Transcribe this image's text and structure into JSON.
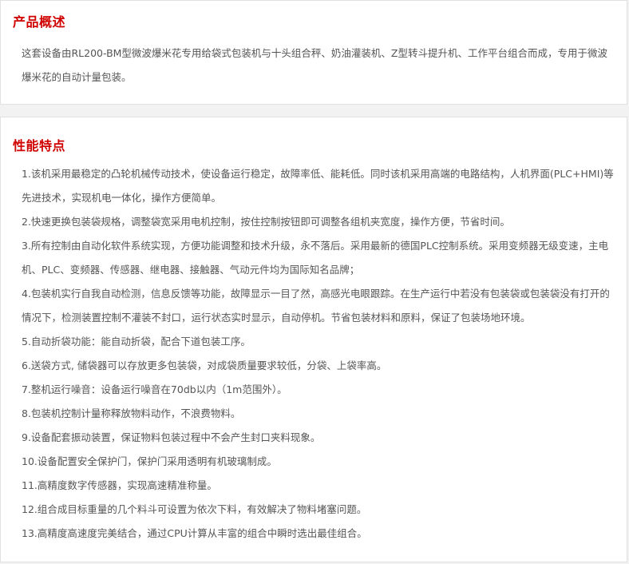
{
  "overview": {
    "title": "产品概述",
    "text": "这套设备由RL200-BM型微波爆米花专用给袋式包装机与十头组合秤、奶油灌装机、Z型转斗提升机、工作平台组合而成，专用于微波爆米花的自动计量包装。"
  },
  "features": {
    "title": "性能特点",
    "items": [
      "1.该机采用最稳定的凸轮机械传动技术，使设备运行稳定，故障率低、能耗低。同时该机采用高端的电路结构，人机界面(PLC+HMI)等先进技术，实现机电一体化，操作方便简单。",
      "2.快速更换包装袋规格，调整袋宽采用电机控制，按住控制按钮即可调整各组机夹宽度，操作方便，节省时间。",
      "3.所有控制由自动化软件系统实现，方便功能调整和技术升级，永不落后。采用最新的德国PLC控制系统。采用变频器无级变速，主电机、PLC、变频器、传感器、继电器、接触器、气动元件均为国际知名品牌；",
      "4.包装机实行自我自动检测，信息反馈等功能，故障显示一目了然，高感光电眼跟踪。在生产运行中若没有包装袋或包装袋没有打开的情况下，检测装置控制不灌装不封口，运行状态实时显示，自动停机。节省包装材料和原料，保证了包装场地环境。",
      "5.自动折袋功能：能自动折袋，配合下道包装工序。",
      "6.送袋方式, 储袋器可以存放更多包装袋，对成袋质量要求较低，分袋、上袋率高。",
      "7.整机运行噪音：设备运行噪音在70db以内（1m范围外）。",
      "8.包装机控制计量称释放物料动作，不浪费物料。",
      "9.设备配套振动装置，保证物料包装过程中不会产生封口夹料现象。",
      "10.设备配置安全保护门，保护门采用透明有机玻璃制成。",
      "11.高精度数字传感器，实现高速精准称量。",
      "12.组合成目标重量的几个料斗可设置为依次下料，有效解决了物料堵塞问题。",
      "13.高精度高速度完美结合，通过CPU计算从丰富的组合中瞬时选出最佳组合。"
    ]
  },
  "colors": {
    "title_red": "#d10000",
    "body_text": "#555555",
    "page_background": "#f2f2f2",
    "panel_border": "#e1e1e1"
  }
}
